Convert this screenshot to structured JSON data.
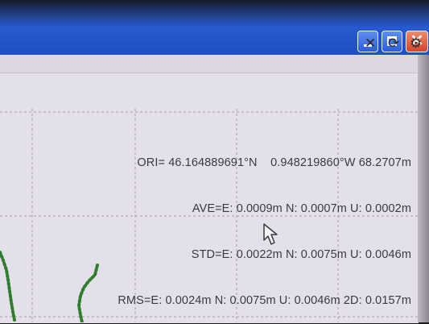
{
  "window": {
    "controls": {
      "minimize": "minimize",
      "maximize": "maximize",
      "close_glyph": "✕"
    }
  },
  "toolbar": {
    "close_glyph": "✕",
    "refresh_glyph": "⟳",
    "settings_glyph": "⚙"
  },
  "readout": {
    "ori": "ORI= 46.164889691°N    0.948219860°W 68.2707m",
    "ave": "AVE=E: 0.0009m N: 0.0007m U: 0.0002m",
    "std": "STD=E: 0.0022m N: 0.0075m U: 0.0046m",
    "rms": "RMS=E: 0.0024m N: 0.0075m U: 0.0046m 2D: 0.0157m"
  },
  "colors": {
    "titlebar": "#2a5ed3",
    "track": "#2f7d2c",
    "panel": "#e4e0ea"
  }
}
